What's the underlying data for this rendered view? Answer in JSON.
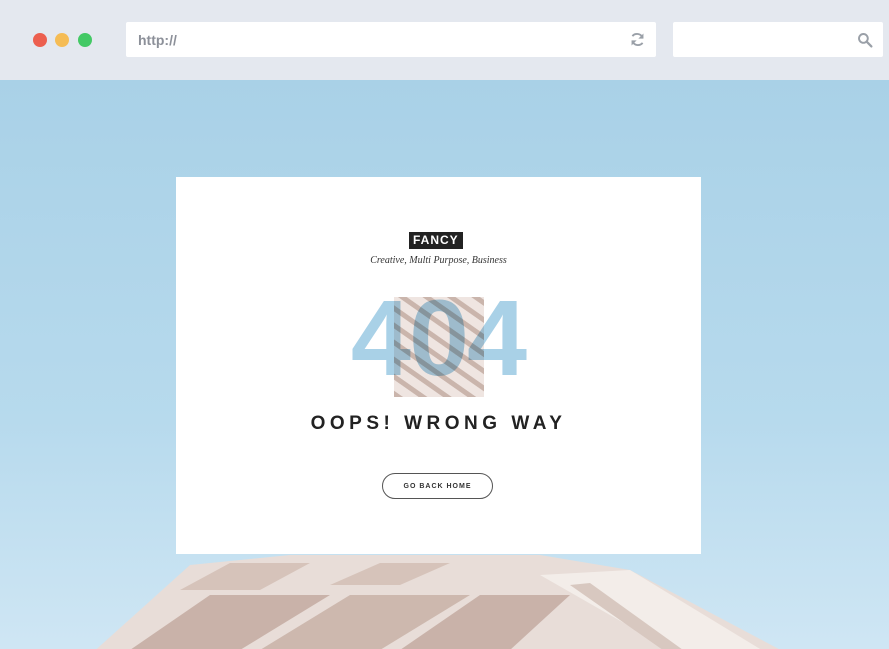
{
  "browser": {
    "url_text": "http://",
    "reload_icon": "reload-icon",
    "search_icon": "search-icon",
    "window_controls": [
      "close",
      "minimize",
      "maximize"
    ]
  },
  "page": {
    "logo": "FANCY",
    "tagline": "Creative, Multi Purpose, Business",
    "error_code": "404",
    "headline": "OOPS! WRONG WAY",
    "button_label": "GO BACK HOME"
  },
  "colors": {
    "accent_blue": "#a9d1e7",
    "logo_bg": "#222222"
  }
}
